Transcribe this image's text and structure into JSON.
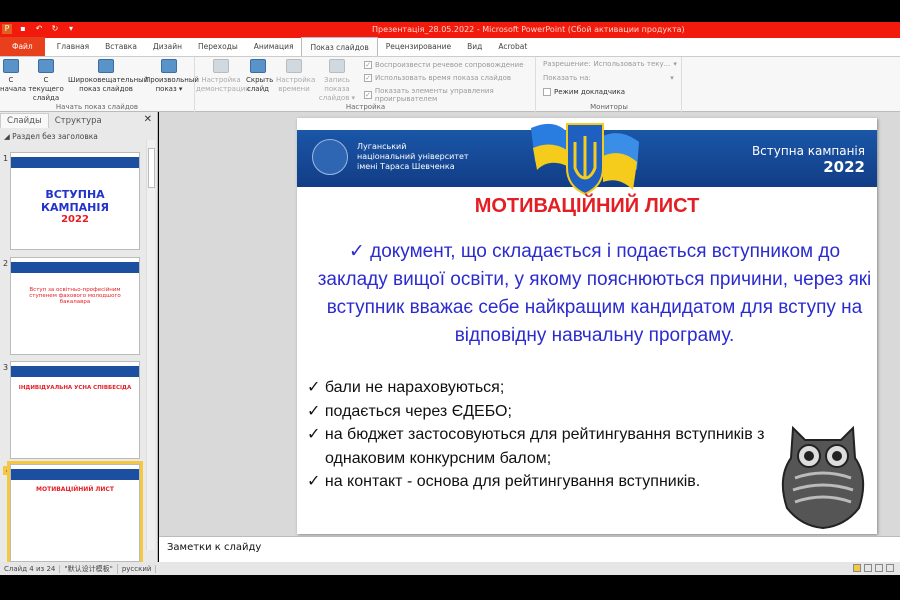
{
  "window": {
    "title": "Презентація_28.05.2022  -  Microsoft PowerPoint (Сбой активации продукта)"
  },
  "tabs": [
    "Файл",
    "Главная",
    "Вставка",
    "Дизайн",
    "Переходы",
    "Анимация",
    "Показ слайдов",
    "Рецензирование",
    "Вид",
    "Acrobat"
  ],
  "ribbon": {
    "start": {
      "label": "Начать показ слайдов",
      "buttons": [
        "С начала",
        "С текущего слайда",
        "Широковещательный показ слайдов",
        "Произвольный показ ▾"
      ]
    },
    "setup": {
      "label": "Настройка",
      "buttons": [
        "Настройка демонстрации",
        "Скрыть слайд",
        "Настройка времени",
        "Запись показа слайдов ▾"
      ],
      "checks": [
        "Воспроизвести речевое сопровождение",
        "Использовать время показа слайдов",
        "Показать элементы управления проигрывателем"
      ]
    },
    "monitors": {
      "label": "Мониторы",
      "resolution_label": "Разрешение:",
      "resolution_value": "Использовать теку...",
      "show_on_label": "Показать на:",
      "presenter_view": "Режим докладчика"
    }
  },
  "panel": {
    "tabs": [
      "Слайды",
      "Структура"
    ],
    "section": "Раздел без заголовка",
    "thumbs": [
      {
        "num": "1",
        "title": "ВСТУПНА КАМПАНІЯ",
        "sub": "2022"
      },
      {
        "num": "2",
        "title": "Вступ за освітньо-професійним ступенем фахового молодшого бакалавра"
      },
      {
        "num": "3",
        "title": "ІНДИВІДУАЛЬНА УСНА СПІВБЕСІДА"
      },
      {
        "num": "4",
        "title": "МОТИВАЦІЙНИЙ ЛИСТ"
      }
    ]
  },
  "slide": {
    "university": [
      "Луганський",
      "національний університет",
      "імені Тараса Шевченка"
    ],
    "campaign": "Вступна кампанія",
    "year": "2022",
    "title": "МОТИВАЦІЙНИЙ ЛИСТ",
    "paragraph": "✓ документ, що складається і подається вступником до закладу вищої освіти, у якому пояснюються причини, через які вступник вважає себе найкращим кандидатом для вступу на відповідну навчальну програму.",
    "bullets": [
      "✓ бали не нараховуються;",
      "✓ подається через ЄДЕБО;",
      "✓ на бюджет застосовуються для рейтингування вступників з однаковим конкурсним балом;",
      "✓ на контакт - основа для рейтингування вступників."
    ]
  },
  "notes": {
    "placeholder": "Заметки к слайду"
  },
  "status": {
    "slide": "Слайд 4 из 24",
    "theme": "\"默认设计模板\"",
    "language": "русский"
  }
}
